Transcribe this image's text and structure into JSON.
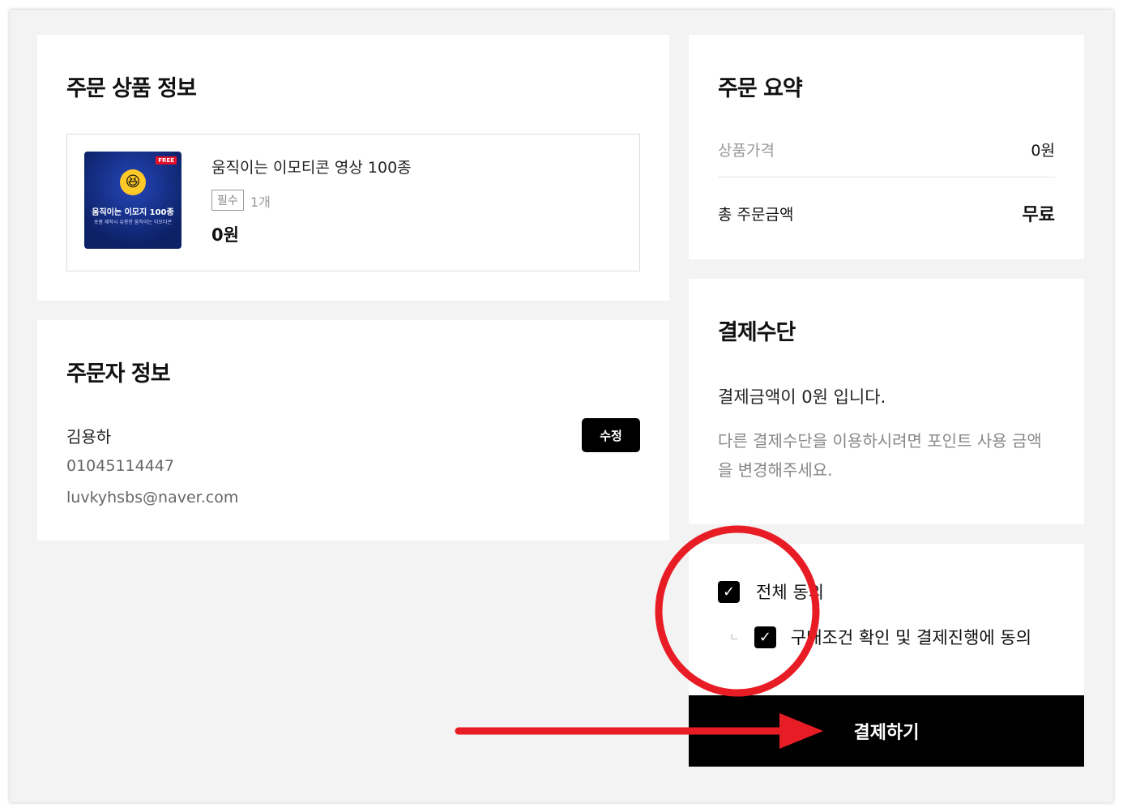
{
  "order_items": {
    "title": "주문 상품 정보",
    "product": {
      "name": "움직이는 이모티콘 영상 100종",
      "required_badge": "필수",
      "quantity": "1개",
      "price": "0원",
      "thumb_title": "움직이는 이모지 100종",
      "thumb_subtitle": "숏폼 제작시 유용한 움직이는 이모티콘",
      "thumb_badge": "FREE"
    }
  },
  "orderer": {
    "title": "주문자 정보",
    "name": "김용하",
    "phone": "01045114447",
    "email": "luvkyhsbs@naver.com",
    "edit_label": "수정"
  },
  "summary": {
    "title": "주문 요약",
    "price_label": "상품가격",
    "price_value": "0원",
    "total_label": "총 주문금액",
    "total_value": "무료"
  },
  "payment": {
    "title": "결제수단",
    "amount_text": "결제금액이 0원 입니다.",
    "note": "다른 결제수단을 이용하시려면 포인트 사용 금액을 변경해주세요."
  },
  "agreement": {
    "all_label": "전체 동의",
    "all_checked": true,
    "sub_prefix": "ㄴ",
    "sub_label": "구매조건 확인 및 결제진행에 동의",
    "sub_checked": true
  },
  "pay_button": "결제하기",
  "colors": {
    "annotation": "#e81c24",
    "button": "#000000"
  }
}
